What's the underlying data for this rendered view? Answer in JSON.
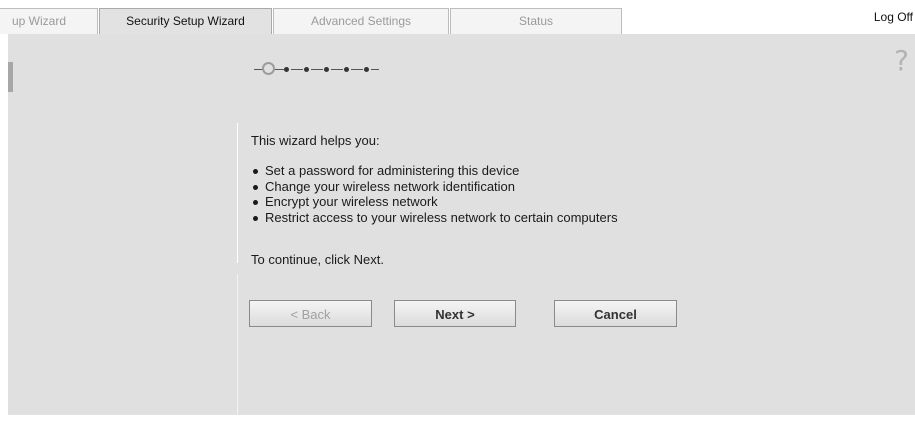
{
  "tabs": [
    {
      "label": "Setup Wizard",
      "visible_text": "up Wizard",
      "active": false
    },
    {
      "label": "Security Setup Wizard",
      "visible_text": "Security Setup Wizard",
      "active": true
    },
    {
      "label": "Advanced Settings",
      "visible_text": "Advanced Settings",
      "active": false
    },
    {
      "label": "Status",
      "visible_text": "Status",
      "active": false
    }
  ],
  "header": {
    "logoff_label": "Log Off"
  },
  "help": {
    "icon": "question-mark-icon",
    "glyph": "?"
  },
  "wizard": {
    "progress": {
      "total_steps": 6,
      "current_step": 1
    },
    "intro": "This wizard helps you:",
    "bullets": [
      "Set a password for administering this device",
      "Change your wireless network identification",
      "Encrypt your wireless network",
      "Restrict access to your wireless network to certain computers"
    ],
    "continue_text": "To continue, click Next."
  },
  "buttons": {
    "back_label": "< Back",
    "next_label": "Next >",
    "cancel_label": "Cancel"
  },
  "colors": {
    "panel_bg": "#e0e0e0",
    "active_tab_bg": "#e2e2e2",
    "inactive_tab_text": "#9a9a9a"
  }
}
